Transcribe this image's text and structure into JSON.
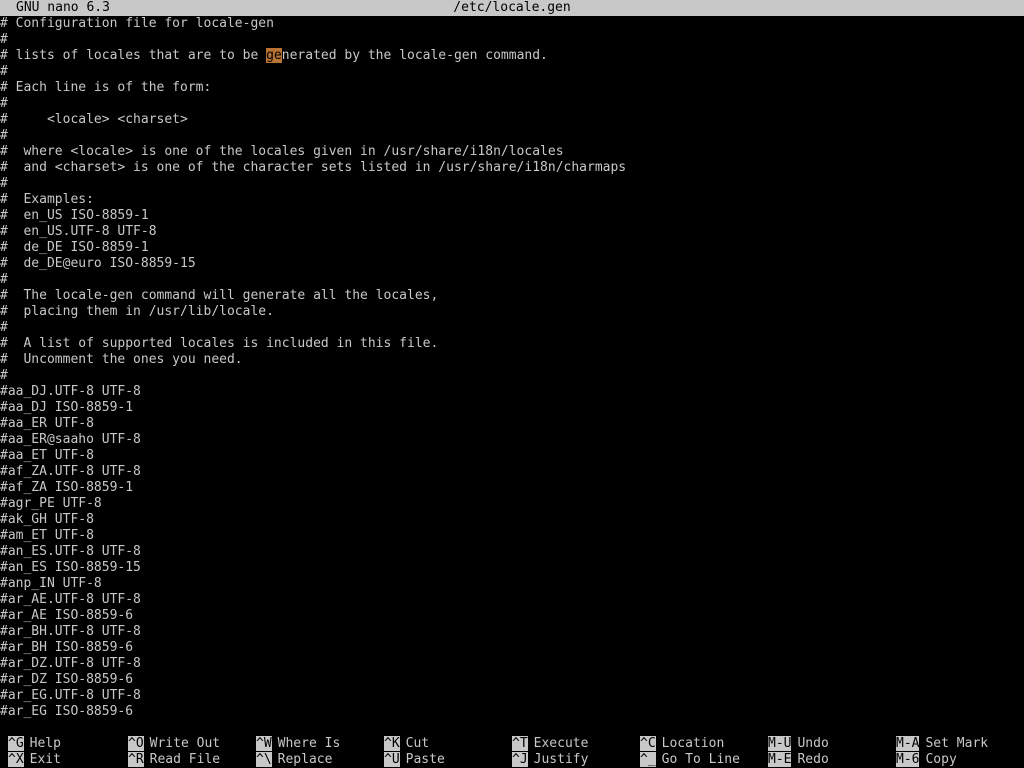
{
  "titlebar": {
    "app": "GNU nano 6.3",
    "file": "/etc/locale.gen"
  },
  "editor": {
    "cursor_line": 2,
    "lines": [
      "# Configuration file for locale-gen",
      "#",
      "# lists of locales that are to be generated by the locale-gen command.",
      "#",
      "# Each line is of the form:",
      "#",
      "#     <locale> <charset>",
      "#",
      "#  where <locale> is one of the locales given in /usr/share/i18n/locales",
      "#  and <charset> is one of the character sets listed in /usr/share/i18n/charmaps",
      "#",
      "#  Examples:",
      "#  en_US ISO-8859-1",
      "#  en_US.UTF-8 UTF-8",
      "#  de_DE ISO-8859-1",
      "#  de_DE@euro ISO-8859-15",
      "#",
      "#  The locale-gen command will generate all the locales,",
      "#  placing them in /usr/lib/locale.",
      "#",
      "#  A list of supported locales is included in this file.",
      "#  Uncomment the ones you need.",
      "#",
      "#aa_DJ.UTF-8 UTF-8",
      "#aa_DJ ISO-8859-1",
      "#aa_ER UTF-8",
      "#aa_ER@saaho UTF-8",
      "#aa_ET UTF-8",
      "#af_ZA.UTF-8 UTF-8",
      "#af_ZA ISO-8859-1",
      "#agr_PE UTF-8",
      "#ak_GH UTF-8",
      "#am_ET UTF-8",
      "#an_ES.UTF-8 UTF-8",
      "#an_ES ISO-8859-15",
      "#anp_IN UTF-8",
      "#ar_AE.UTF-8 UTF-8",
      "#ar_AE ISO-8859-6",
      "#ar_BH.UTF-8 UTF-8",
      "#ar_BH ISO-8859-6",
      "#ar_DZ.UTF-8 UTF-8",
      "#ar_DZ ISO-8859-6",
      "#ar_EG.UTF-8 UTF-8",
      "#ar_EG ISO-8859-6"
    ],
    "cursor_prefix": "# lists of locales that are to be ",
    "cursor_text": "ge",
    "cursor_suffix": "nerated by the locale-gen command."
  },
  "shortcuts": [
    {
      "key": "^G",
      "label": "Help"
    },
    {
      "key": "^X",
      "label": "Exit"
    },
    {
      "key": "^O",
      "label": "Write Out"
    },
    {
      "key": "^R",
      "label": "Read File"
    },
    {
      "key": "^W",
      "label": "Where Is"
    },
    {
      "key": "^\\",
      "label": "Replace"
    },
    {
      "key": "^K",
      "label": "Cut"
    },
    {
      "key": "^U",
      "label": "Paste"
    },
    {
      "key": "^T",
      "label": "Execute"
    },
    {
      "key": "^J",
      "label": "Justify"
    },
    {
      "key": "^C",
      "label": "Location"
    },
    {
      "key": "^_",
      "label": "Go To Line"
    },
    {
      "key": "M-U",
      "label": "Undo"
    },
    {
      "key": "M-E",
      "label": "Redo"
    },
    {
      "key": "M-A",
      "label": "Set Mark"
    },
    {
      "key": "M-6",
      "label": "Copy"
    }
  ],
  "colors": {
    "background": "#000000",
    "foreground": "#c8c8c8",
    "cursor_highlight": "#b87333"
  }
}
